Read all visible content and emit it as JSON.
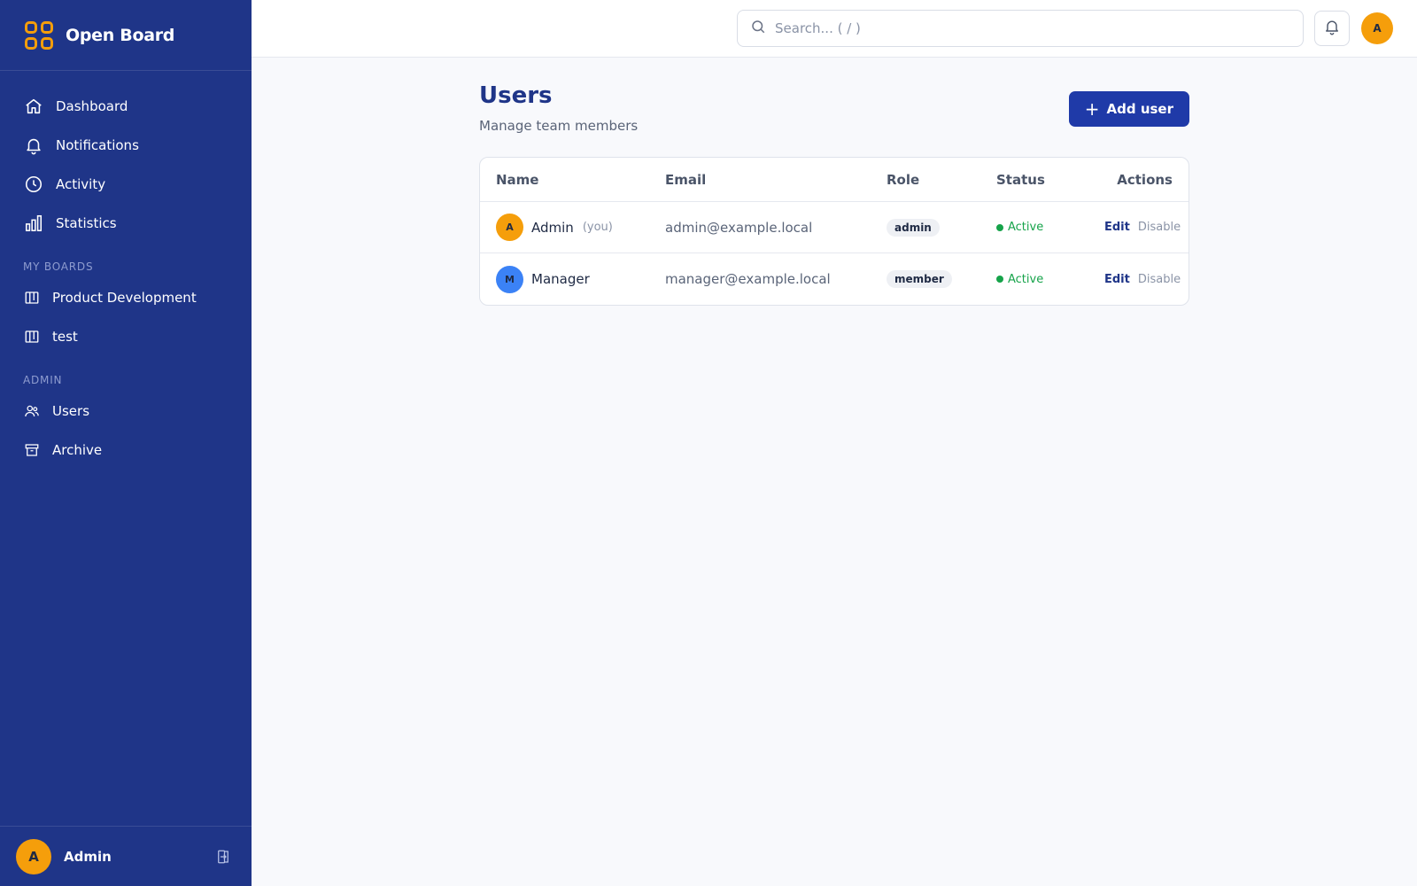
{
  "app": {
    "name": "Open Board"
  },
  "sidebar": {
    "items": [
      {
        "label": "Dashboard",
        "icon": "home-icon"
      },
      {
        "label": "Notifications",
        "icon": "bell-icon"
      },
      {
        "label": "Activity",
        "icon": "clock-icon"
      },
      {
        "label": "Statistics",
        "icon": "bar-chart-icon"
      }
    ],
    "boards_section": "MY BOARDS",
    "boards": [
      {
        "label": "Product Development",
        "icon": "board-icon"
      },
      {
        "label": "test",
        "icon": "board-icon"
      }
    ],
    "admin_section": "ADMIN",
    "admin_items": [
      {
        "label": "Users",
        "icon": "users-icon"
      },
      {
        "label": "Archive",
        "icon": "archive-icon"
      }
    ],
    "footer": {
      "avatar_initial": "A",
      "name": "Admin"
    }
  },
  "topbar": {
    "search_placeholder": "Search... ( / )",
    "avatar_initial": "A"
  },
  "page": {
    "title": "Users",
    "subtitle": "Manage team members",
    "add_button": "Add user"
  },
  "table": {
    "headers": {
      "name": "Name",
      "email": "Email",
      "role": "Role",
      "status": "Status",
      "actions": "Actions"
    },
    "rows": [
      {
        "initial": "A",
        "name": "Admin",
        "you": "(you)",
        "email": "admin@example.local",
        "role": "admin",
        "status": "Active",
        "edit": "Edit",
        "disable": "Disable",
        "avatar_color": "#f59e0b"
      },
      {
        "initial": "M",
        "name": "Manager",
        "you": "",
        "email": "manager@example.local",
        "role": "member",
        "status": "Active",
        "edit": "Edit",
        "disable": "Disable",
        "avatar_color": "#3b82f6"
      }
    ]
  },
  "colors": {
    "sidebar_bg": "#1f3588",
    "accent": "#f59e0b",
    "primary_button": "#1f3aa8",
    "status_active": "#16a34a"
  }
}
